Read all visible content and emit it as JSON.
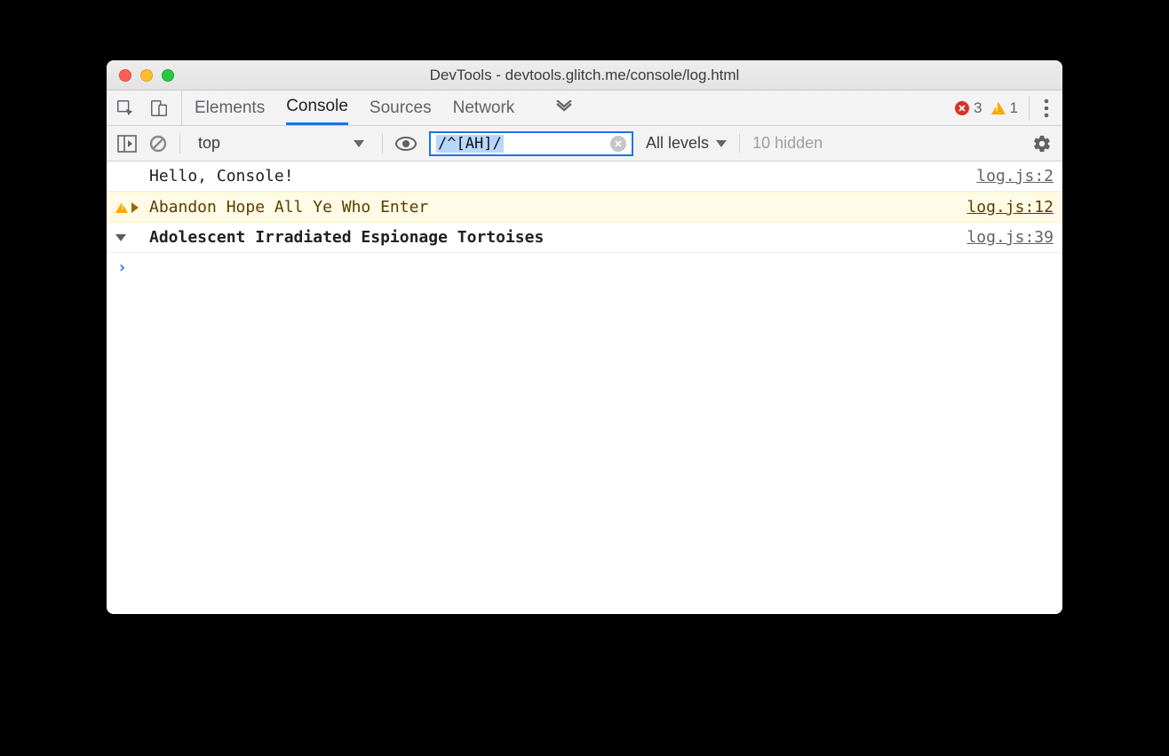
{
  "window": {
    "title": "DevTools - devtools.glitch.me/console/log.html"
  },
  "tabs": {
    "elements": "Elements",
    "console": "Console",
    "sources": "Sources",
    "network": "Network"
  },
  "status": {
    "errors": "3",
    "warnings": "1"
  },
  "toolbar": {
    "context": "top",
    "filter": "/^[AH]/",
    "levels": "All levels",
    "hidden": "10 hidden"
  },
  "rows": [
    {
      "type": "log",
      "message": "Hello, Console!",
      "source": "log.js:2"
    },
    {
      "type": "warn",
      "message": "Abandon Hope All Ye Who Enter",
      "source": "log.js:12",
      "expandable": true,
      "expanded": false
    },
    {
      "type": "group",
      "message": "Adolescent Irradiated Espionage Tortoises",
      "source": "log.js:39",
      "expandable": true,
      "expanded": true
    }
  ]
}
